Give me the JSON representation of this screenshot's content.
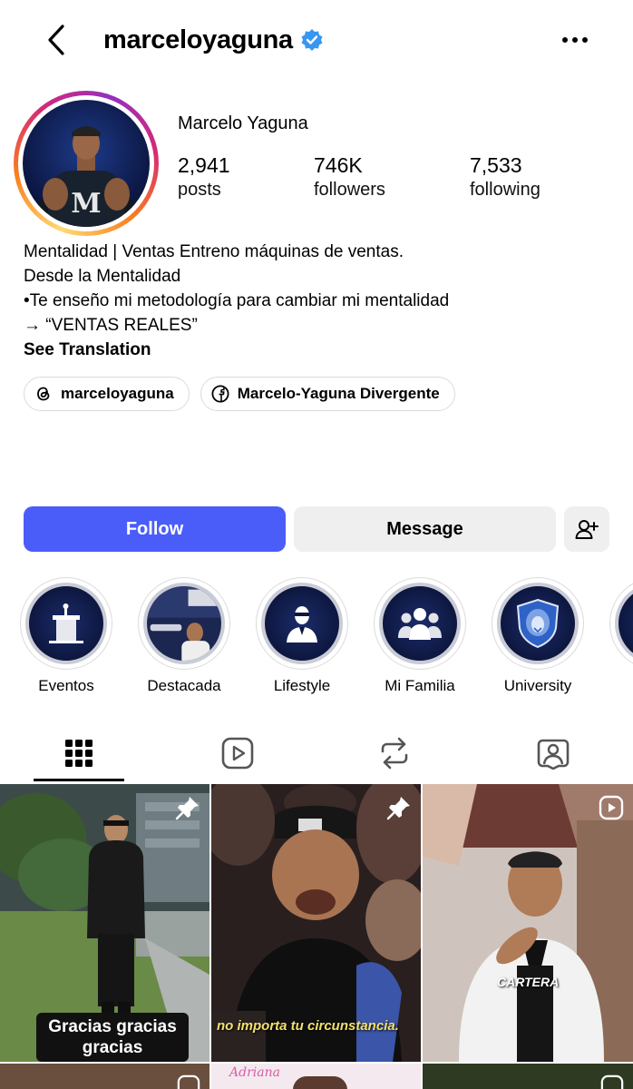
{
  "header": {
    "username": "marceloyaguna",
    "verified": true,
    "back_icon": "chevron-left-icon",
    "more_icon": "more-horizontal-icon"
  },
  "profile": {
    "display_name": "Marcelo Yaguna",
    "stats": [
      {
        "count": "2,941",
        "label": "posts"
      },
      {
        "count": "746K",
        "label": "followers"
      },
      {
        "count": "7,533",
        "label": "following"
      }
    ],
    "bio": [
      "Mentalidad | Ventas Entreno máquinas de ventas.",
      "Desde la Mentalidad",
      "•Te enseño mi metodología para cambiar mi mentalidad",
      "→ “VENTAS REALES”"
    ],
    "see_translation": "See Translation",
    "links": [
      {
        "icon": "threads-icon",
        "label": "marceloyaguna"
      },
      {
        "icon": "facebook-icon",
        "label": "Marcelo-Yaguna Divergente"
      }
    ]
  },
  "actions": {
    "follow": "Follow",
    "message": "Message",
    "add_icon": "add-user-icon"
  },
  "highlights": [
    {
      "label": "Eventos",
      "icon": "podium-icon"
    },
    {
      "label": "Destacada",
      "icon": "photo"
    },
    {
      "label": "Lifestyle",
      "icon": "person-suit-icon"
    },
    {
      "label": "Mi Familia",
      "icon": "group-icon"
    },
    {
      "label": "University",
      "icon": "lion-shield-icon"
    }
  ],
  "tabs": [
    {
      "name": "grid",
      "icon": "grid-icon",
      "active": true
    },
    {
      "name": "reels",
      "icon": "reels-icon"
    },
    {
      "name": "reposts",
      "icon": "repost-icon"
    },
    {
      "name": "tagged",
      "icon": "tagged-icon"
    }
  ],
  "posts": [
    {
      "caption": "Gracias gracias gracias",
      "pinned": true
    },
    {
      "caption": "no importa tu circunstancia.",
      "pinned": true
    },
    {
      "caption": "CARTERA",
      "reel": true
    }
  ],
  "bottom_row": {
    "script_text": "Adriana"
  },
  "colors": {
    "accent": "#4a5df9",
    "verified": "#3897f0",
    "button_grey": "#efefef"
  }
}
